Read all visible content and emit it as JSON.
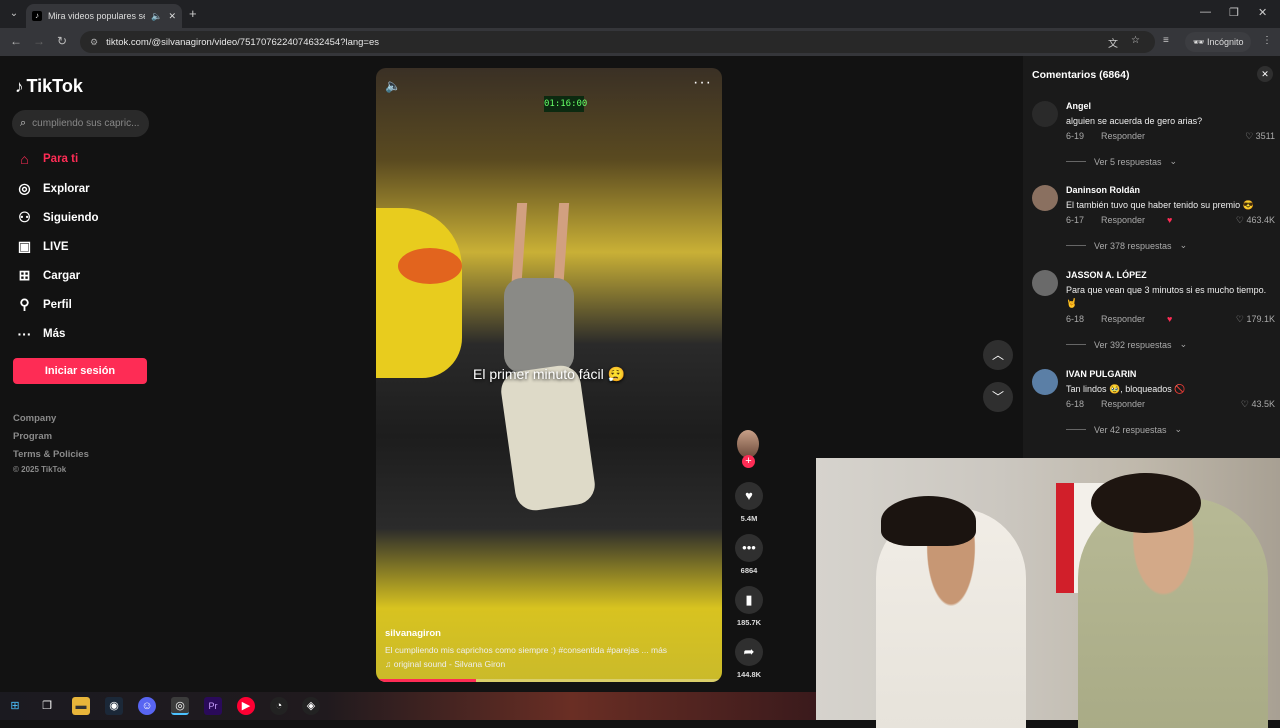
{
  "browser": {
    "tab_title": "Mira videos populares sele",
    "url": "tiktok.com/@silvanagiron/video/7517076224074632454?lang=es",
    "incognito_label": "Incógnito"
  },
  "sidebar": {
    "logo": "TikTok",
    "search_placeholder": "cumpliendo sus capric...",
    "nav": [
      {
        "label": "Para ti",
        "icon": "home-icon"
      },
      {
        "label": "Explorar",
        "icon": "compass-icon"
      },
      {
        "label": "Siguiendo",
        "icon": "following-icon"
      },
      {
        "label": "LIVE",
        "icon": "live-icon"
      },
      {
        "label": "Cargar",
        "icon": "upload-icon"
      },
      {
        "label": "Perfil",
        "icon": "profile-icon"
      },
      {
        "label": "Más",
        "icon": "more-icon"
      }
    ],
    "login_label": "Iniciar sesión",
    "footer": [
      "Company",
      "Program",
      "Terms & Policies"
    ],
    "copyright": "© 2025 TikTok"
  },
  "video": {
    "caption": "El primer minuto fácil 😮‍💨",
    "clock": "01:16:00",
    "author": "silvanagiron",
    "description": "El cumpliendo mis caprichos como siempre :) #consentida #parejas ... más",
    "sound": "♫ original sound - Silvana Giron",
    "progress": 0.29
  },
  "actions": {
    "likes": "5.4M",
    "comments": "6864",
    "saves": "185.7K",
    "shares": "144.8K"
  },
  "comments": {
    "title": "Comentarios (6864)",
    "items": [
      {
        "name": "Angel",
        "text": "alguien se acuerda de gero arias?",
        "date": "6-19",
        "reply": "Responder",
        "likes": "3511",
        "more": "Ver 5 respuestas"
      },
      {
        "name": "Daninson Roldán",
        "text": "El también tuvo que haber tenido su premio 😎",
        "date": "6-17",
        "reply": "Responder",
        "likes": "463.4K",
        "more": "Ver 378 respuestas"
      },
      {
        "name": "JASSON A. LÓPEZ",
        "text": "Para que vean que 3 minutos si es mucho tiempo. 🤘",
        "date": "6-18",
        "reply": "Responder",
        "likes": "179.1K",
        "more": "Ver 392 respuestas"
      },
      {
        "name": "IVAN PULGARIN",
        "text": "Tan lindos 🥹, bloqueados 🚫",
        "date": "6-18",
        "reply": "Responder",
        "likes": "43.5K",
        "more": "Ver 42 respuestas"
      }
    ]
  },
  "colors": {
    "accent": "#fe2c55",
    "background": "#121212",
    "panel": "#1a1a1a"
  }
}
